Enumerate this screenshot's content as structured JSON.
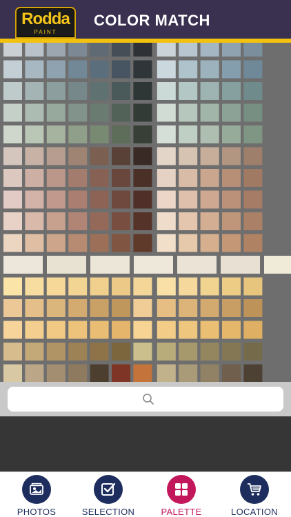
{
  "header": {
    "logo_name": "Rodda",
    "logo_sub": "PAINT",
    "title": "COLOR MATCH"
  },
  "palette": {
    "rows": [
      [
        "#c9cfd2",
        "#b9c2c9",
        "#9ba6ae",
        "#7c8893",
        "#5f6a74",
        "#454e56",
        "#2e3236",
        "#c9d3d8",
        "#b8c6cf",
        "#a4b6c2",
        "#8ea2b0",
        "#7a8e9c"
      ],
      [
        "#c4cfd5",
        "#a7b8c3",
        "#8ea2b0",
        "#728897",
        "#5a6e7c",
        "#475562",
        "#2f3539",
        "#cbd8dd",
        "#afc3cc",
        "#9cb3be",
        "#859ead",
        "#6f8998"
      ],
      [
        "#bfcbcb",
        "#a4b3b3",
        "#8d9e9f",
        "#768889",
        "#5f7171",
        "#4a5a5b",
        "#2e3636",
        "#cbdad6",
        "#b3c7c5",
        "#9db4b3",
        "#86a0a0",
        "#708b8c"
      ],
      [
        "#c5d0c8",
        "#adbcb2",
        "#97a89d",
        "#81938a",
        "#6a7c72",
        "#526259",
        "#333b37",
        "#d0dcd4",
        "#b6c8bd",
        "#a2b5a9",
        "#8ca296",
        "#778e82"
      ],
      [
        "#cfd6cb",
        "#bac6b6",
        "#a6b39f",
        "#909f89",
        "#798a73",
        "#5e6d5a",
        "#373f36",
        "#d6dfd7",
        "#c0cfc3",
        "#aebfb1",
        "#97ab9a",
        "#809684"
      ],
      [
        "#d5c6bd",
        "#c7b2a5",
        "#b69d8f",
        "#9f8473",
        "#7b5f51",
        "#5a4137",
        "#3a2a26",
        "#e3d6c9",
        "#d6c3b2",
        "#c7ae9b",
        "#b39682",
        "#9d7f6b"
      ],
      [
        "#ddc8bf",
        "#cdb0a3",
        "#bb978a",
        "#a47c6e",
        "#876154",
        "#6a473c",
        "#4b3028",
        "#e6d2c4",
        "#d9bca7",
        "#caa68f",
        "#b78f77",
        "#a07a62"
      ],
      [
        "#e2cbc4",
        "#d3b2a7",
        "#c19a8d",
        "#aa7f72",
        "#8d6356",
        "#6f493e",
        "#4f2f27",
        "#ecd6c8",
        "#dfc0ac",
        "#cfa892",
        "#bc917a",
        "#a67c66"
      ],
      [
        "#e8d2c7",
        "#d9b9aa",
        "#c7a08e",
        "#b08575",
        "#946959",
        "#774e40",
        "#563329",
        "#efdccb",
        "#e3c6ad",
        "#d3ae93",
        "#c0967b",
        "#aa8066"
      ],
      [
        "#ecd6c2",
        "#dfbea4",
        "#cda58a",
        "#b78b72",
        "#9c7058",
        "#805643",
        "#5f3a2b",
        "#f1dfc9",
        "#e6c9aa",
        "#d6b08e",
        "#c49876",
        "#ae8263"
      ],
      [
        "#ede7db",
        "#e7e2d2",
        "#ece6d8",
        "#eee8da",
        "#ebe4d6",
        "#e8e0d2",
        "#f0ead9"
      ],
      [
        "#fbe4a8",
        "#f8dda0",
        "#f6d899",
        "#f3d593",
        "#f0d08c",
        "#ecc986",
        "#f4d798",
        "#f8e0a7",
        "#f5d99c",
        "#f1d48f",
        "#edcd86",
        "#e7c57c"
      ],
      [
        "#ebc896",
        "#e4bf89",
        "#dab57c",
        "#d3ab70",
        "#c9a066",
        "#bf965c",
        "#f0cc96",
        "#e6be83",
        "#dcb378",
        "#d2a96e",
        "#c89e64",
        "#be935a"
      ],
      [
        "#f7d49a",
        "#f4ce8e",
        "#f1c985",
        "#edc37c",
        "#e9bd73",
        "#e4b56a",
        "#f7d494",
        "#f3cd88",
        "#efc67e",
        "#eabf74",
        "#e5b76b",
        "#dfb063"
      ],
      [
        "#d7bc8e",
        "#c4a978",
        "#b09465",
        "#9d8255",
        "#8d7347",
        "#7c663d",
        "#ccbf8e",
        "#b9ac7b",
        "#a6996b",
        "#948760",
        "#847854",
        "#756a49"
      ],
      [
        "#d8c8a4",
        "#bba788",
        "#a48e72",
        "#8e7a5f",
        "#4d3f30",
        "#7e3526",
        "#c4733a",
        "#c2b28c",
        "#a99a78",
        "#918266",
        "#6f5f4c",
        "#4d4133"
      ]
    ]
  },
  "search": {
    "placeholder": "",
    "icon": "search-icon"
  },
  "tabs": [
    {
      "label": "PHOTOS",
      "icon": "photos-icon",
      "active": false
    },
    {
      "label": "SELECTION",
      "icon": "checkbox-icon",
      "active": false
    },
    {
      "label": "PALETTE",
      "icon": "grid-icon",
      "active": true
    },
    {
      "label": "LOCATION",
      "icon": "cart-icon",
      "active": false
    }
  ],
  "colors": {
    "header_bg": "#3a3050",
    "accent_yellow": "#f2c20f",
    "tab_blue": "#1d2e5e",
    "tab_active": "#c2185b"
  }
}
